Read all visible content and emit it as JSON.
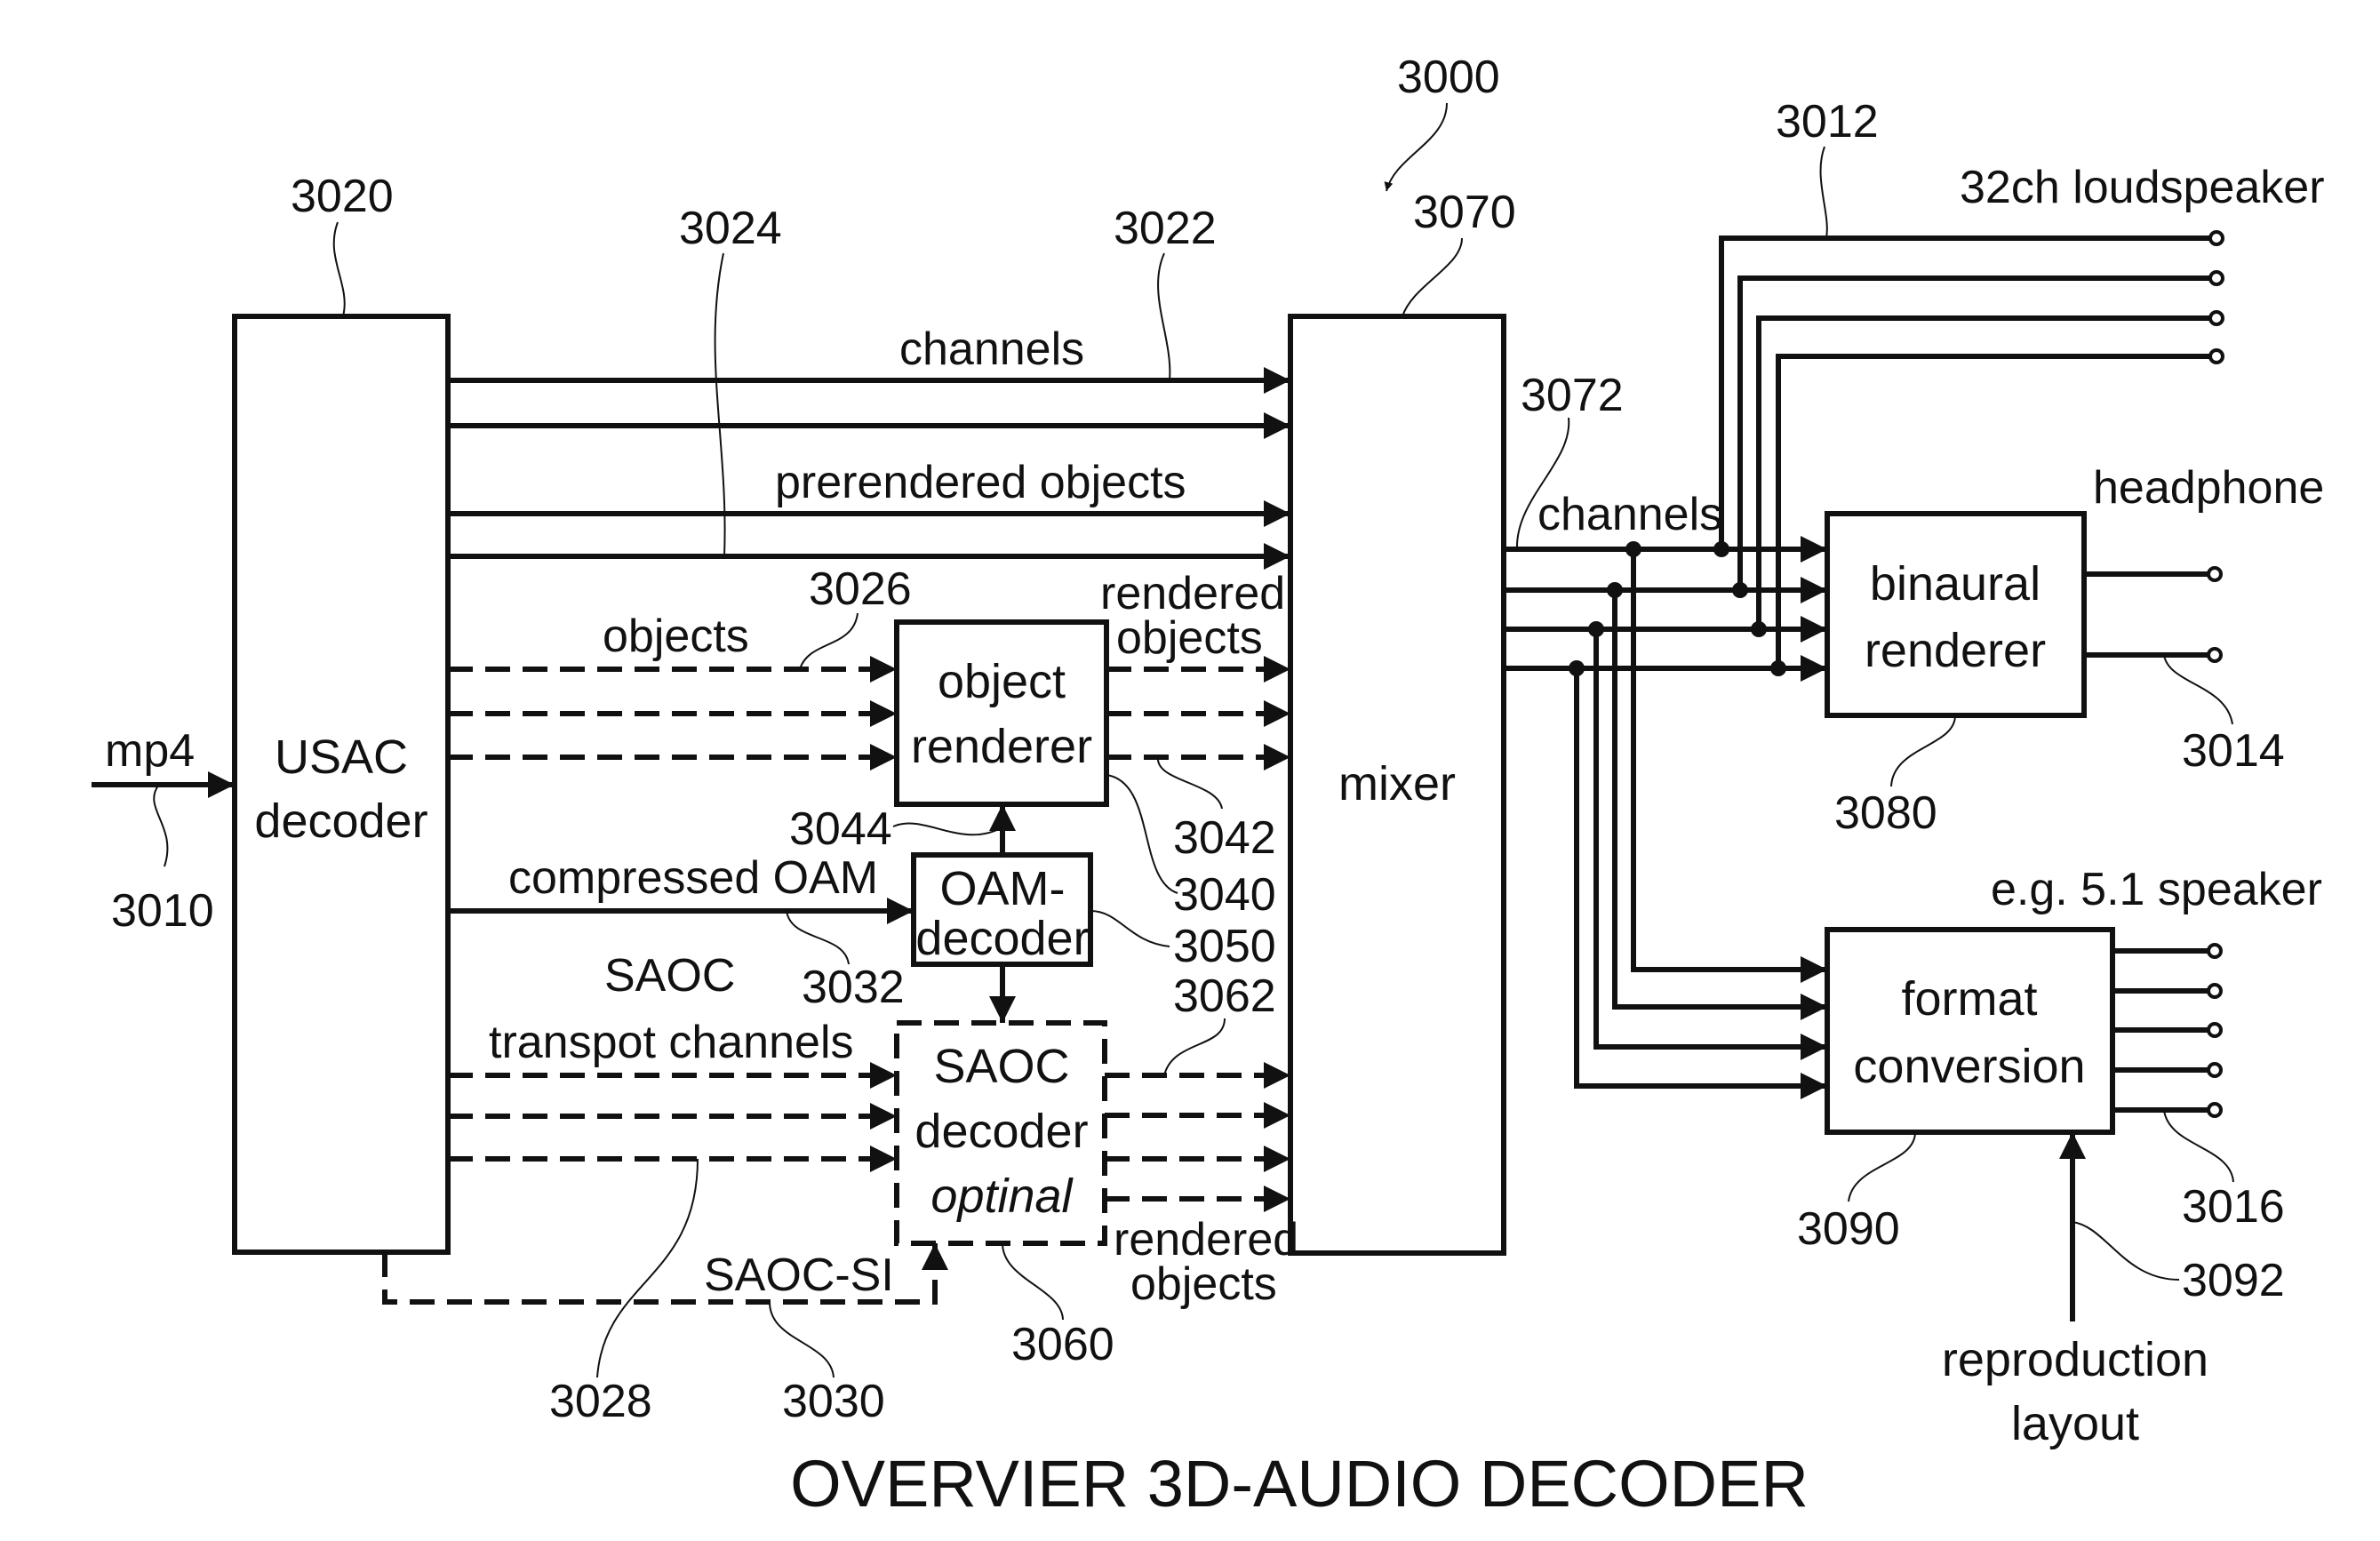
{
  "figure": {
    "title": "OVERVIER 3D-AUDIO DECODER",
    "reference": "3000",
    "colors": {
      "ink": "#111111",
      "paper": "#ffffff"
    }
  },
  "input": {
    "label": "mp4",
    "ref": "3010"
  },
  "blocks": {
    "usac": {
      "line1": "USAC",
      "line2": "decoder",
      "ref": "3020"
    },
    "object_renderer": {
      "line1": "object",
      "line2": "renderer",
      "ref": "3040"
    },
    "oam_decoder": {
      "line1": "OAM-",
      "line2": "decoder",
      "ref": "3050"
    },
    "saoc_decoder": {
      "line1": "SAOC",
      "line2": "decoder",
      "line3": "optinal",
      "ref": "3060"
    },
    "mixer": {
      "line1": "mixer",
      "ref": "3070"
    },
    "binaural": {
      "line1": "binaural",
      "line2": "renderer",
      "ref": "3080"
    },
    "format": {
      "line1": "format",
      "line2": "conversion",
      "ref": "3090"
    }
  },
  "signals": {
    "channels": {
      "label": "channels",
      "ref": "3022"
    },
    "prerendered": {
      "label": "prerendered objects",
      "ref": "3024"
    },
    "objects": {
      "label": "objects",
      "ref": "3026"
    },
    "saoc_transport": {
      "line1": "SAOC",
      "line2": "transpot channels",
      "ref": "3028"
    },
    "saoc_si": {
      "label": "SAOC-SI",
      "ref": "3030"
    },
    "compressed_oam": {
      "label": "compressed OAM",
      "ref": "3032"
    },
    "rendered_objects_or": {
      "line1": "rendered",
      "line2": "objects",
      "ref": "3042"
    },
    "oam_to_renderer": {
      "ref": "3044"
    },
    "rendered_objects_saoc": {
      "line1": "rendered",
      "line2": "objects",
      "ref": "3062"
    },
    "mixer_channels": {
      "label": "channels",
      "ref": "3072"
    },
    "reproduction_layout": {
      "line1": "reproduction",
      "line2": "layout",
      "ref": "3092"
    }
  },
  "outputs": {
    "loudspeaker": {
      "label": "32ch loudspeaker",
      "ref": "3012"
    },
    "headphone": {
      "label": "headphone",
      "ref": "3014"
    },
    "speaker51": {
      "label": "e.g. 5.1 speaker",
      "ref": "3016"
    }
  }
}
